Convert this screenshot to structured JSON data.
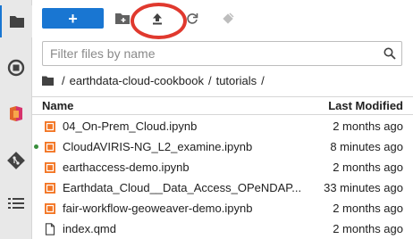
{
  "toolbar": {
    "new_label": "+",
    "accent_color": "#1976d2",
    "highlight_color": "#e0392e",
    "icons": [
      "new-folder-icon",
      "upload-icon",
      "refresh-icon",
      "git-clone-icon"
    ]
  },
  "filter": {
    "placeholder": "Filter files by name",
    "value": ""
  },
  "breadcrumb": {
    "home_icon": "folder-icon",
    "separator": "/",
    "segments": [
      "earthdata-cloud-cookbook",
      "tutorials"
    ],
    "trailing": "/"
  },
  "columns": {
    "name": "Name",
    "modified": "Last Modified"
  },
  "files": [
    {
      "name": "04_On-Prem_Cloud.ipynb",
      "modified": "2 months ago",
      "icon": "notebook-icon",
      "running": false
    },
    {
      "name": "CloudAVIRIS-NG_L2_examine.ipynb",
      "modified": "8 minutes ago",
      "icon": "notebook-icon",
      "running": true
    },
    {
      "name": "earthaccess-demo.ipynb",
      "modified": "2 months ago",
      "icon": "notebook-icon",
      "running": false
    },
    {
      "name": "Earthdata_Cloud__Data_Access_OPeNDAP...",
      "modified": "33 minutes ago",
      "icon": "notebook-icon",
      "running": false
    },
    {
      "name": "fair-workflow-geoweaver-demo.ipynb",
      "modified": "2 months ago",
      "icon": "notebook-icon",
      "running": false
    },
    {
      "name": "index.qmd",
      "modified": "2 months ago",
      "icon": "file-icon",
      "running": false
    }
  ],
  "sidebar": [
    "file-browser-icon",
    "running-kernels-icon",
    "extension-manager-icon",
    "git-icon",
    "table-of-contents-icon"
  ]
}
